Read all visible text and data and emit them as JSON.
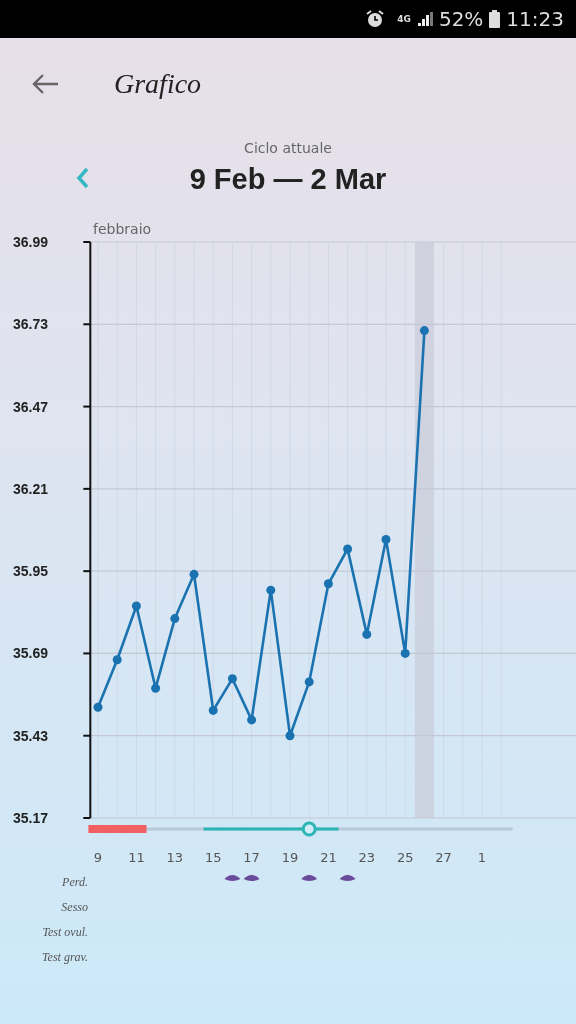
{
  "status_bar": {
    "network": "4G",
    "battery": "52%",
    "time": "11:23"
  },
  "header": {
    "title": "Grafico"
  },
  "cycle": {
    "label": "Ciclo attuale",
    "range": "9 Feb — 2 Mar"
  },
  "chart": {
    "month": "febbraio",
    "chart_data": {
      "type": "line",
      "x": [
        9,
        10,
        11,
        12,
        13,
        14,
        15,
        16,
        17,
        18,
        19,
        20,
        21,
        22,
        23,
        24,
        25,
        26
      ],
      "series": [
        {
          "color": "#1a73b0",
          "marker": "circle",
          "values": [
            35.52,
            35.67,
            35.84,
            35.58,
            35.8,
            35.94,
            35.51,
            35.61,
            35.48,
            35.89,
            35.43,
            35.6,
            35.91,
            36.02,
            35.75,
            36.05,
            35.69,
            36.71
          ]
        }
      ],
      "xlim": [
        8.6,
        30.6
      ],
      "grid": true,
      "ylim": [
        35.17,
        36.99
      ],
      "yticks": [
        35.17,
        35.43,
        35.69,
        35.95,
        36.21,
        36.47,
        36.73,
        36.99
      ],
      "xticks": [
        9,
        11,
        13,
        15,
        17,
        19,
        21,
        23,
        25,
        27
      ],
      "bands": [
        {
          "axis": "x",
          "from": 25.5,
          "to": 26.5
        }
      ]
    },
    "next_month_day": "1",
    "timeline": [
      {
        "kind": "period"
      },
      {
        "kind": "period"
      },
      {
        "kind": "period"
      },
      {
        "kind": "none"
      },
      {
        "kind": "none"
      },
      {
        "kind": "none"
      },
      {
        "kind": "fertile"
      },
      {
        "kind": "fertile"
      },
      {
        "kind": "fertile"
      },
      {
        "kind": "fertile"
      },
      {
        "kind": "fertile"
      },
      {
        "kind": "ovulation"
      },
      {
        "kind": "fertile"
      },
      {
        "kind": "none"
      },
      {
        "kind": "none"
      },
      {
        "kind": "none"
      },
      {
        "kind": "none"
      },
      {
        "kind": "none"
      },
      {
        "kind": "none"
      },
      {
        "kind": "none"
      },
      {
        "kind": "none"
      },
      {
        "kind": "none"
      }
    ],
    "rows": [
      {
        "label": "Perd.",
        "days": [
          {
            "kind": "none"
          },
          {
            "kind": "none"
          },
          {
            "kind": "none"
          },
          {
            "kind": "none"
          },
          {
            "kind": "none"
          },
          {
            "kind": "none"
          },
          {
            "kind": "none"
          },
          {
            "kind": "spotting"
          },
          {
            "kind": "spotting"
          },
          {
            "kind": "none"
          },
          {
            "kind": "none"
          },
          {
            "kind": "spotting"
          },
          {
            "kind": "none"
          },
          {
            "kind": "spotting"
          },
          {
            "kind": "none"
          },
          {
            "kind": "none"
          },
          {
            "kind": "none"
          },
          {
            "kind": "none"
          },
          {
            "kind": "none"
          },
          {
            "kind": "none"
          },
          {
            "kind": "none"
          },
          {
            "kind": "none"
          }
        ]
      },
      {
        "label": "Sesso"
      },
      {
        "label": "Test ovul."
      },
      {
        "label": "Test grav."
      }
    ]
  }
}
